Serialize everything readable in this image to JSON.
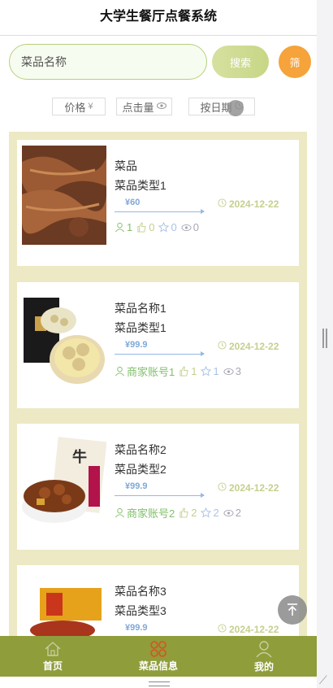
{
  "header": {
    "title": "大学生餐厅点餐系统"
  },
  "search": {
    "placeholder": "菜品名称",
    "button": "搜索",
    "filter": "筛"
  },
  "sort": [
    {
      "label": "价格",
      "icon": "¥"
    },
    {
      "label": "点击量",
      "icon": "eye-icon"
    },
    {
      "label": "按日期",
      "icon": "clock-icon"
    }
  ],
  "items": [
    {
      "name": "菜品",
      "type": "菜品类型1",
      "price": "¥60",
      "date": "2024-12-22",
      "merchant": "",
      "likes": "1",
      "likes2": "0",
      "stars": "0",
      "views": "0",
      "user_count": "1"
    },
    {
      "name": "菜品名称1",
      "type": "菜品类型1",
      "price": "¥99.9",
      "date": "2024-12-22",
      "merchant": "商家账号1",
      "likes": "1",
      "stars": "1",
      "views": "3"
    },
    {
      "name": "菜品名称2",
      "type": "菜品类型2",
      "price": "¥99.9",
      "date": "2024-12-22",
      "merchant": "商家账号2",
      "likes": "2",
      "stars": "2",
      "views": "2"
    },
    {
      "name": "菜品名称3",
      "type": "菜品类型3",
      "price": "¥99.9",
      "date": "2024-12-22"
    }
  ],
  "tabs": [
    {
      "label": "首页",
      "icon": "home-icon"
    },
    {
      "label": "菜品信息",
      "icon": "grid-icon",
      "accent": "#d9531e"
    },
    {
      "label": "我的",
      "icon": "user-icon"
    }
  ],
  "colors": {
    "accent": "#8f9d3b",
    "filter": "#f5a33a",
    "list_bg": "#ece9c4"
  }
}
